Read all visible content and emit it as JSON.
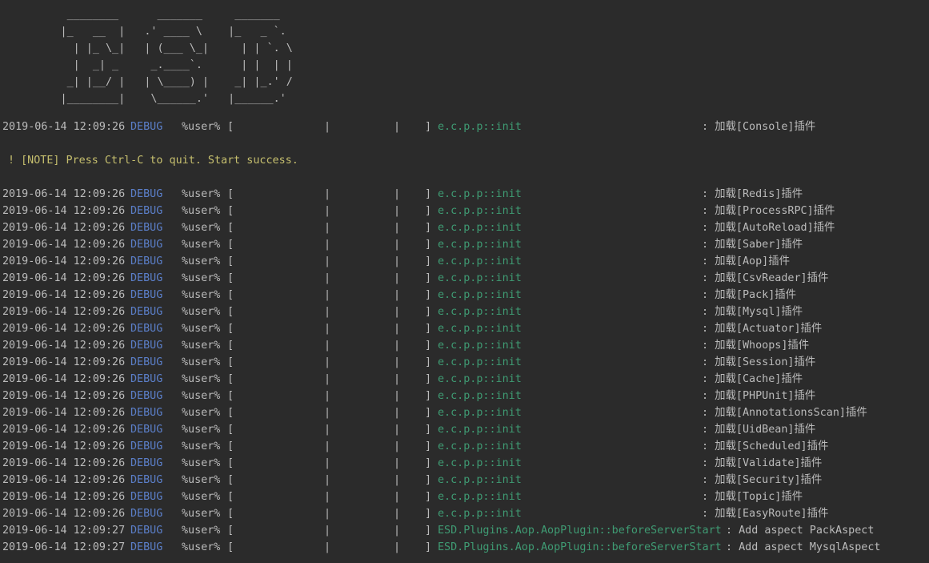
{
  "banner": [
    "          ________      _______     _______",
    "         |_   __  |   .' ____ \\    |_   _ `.",
    "           | |_ \\_|   | (___ \\_|     | | `. \\",
    "           |  _| _     _.____`.      | |  | |",
    "          _| |__/ |   | \\____) |    _| |_.' /",
    "         |________|    \\______.'   |______.'"
  ],
  "first_row": {
    "date": "2019-06-14 12:09:26",
    "level": "DEBUG",
    "user": "%user%",
    "lb": "[",
    "p1": "|",
    "p2": "|",
    "rb": "]",
    "source": "e.c.p.p::init",
    "message": ": 加载[Console]插件"
  },
  "note": "! [NOTE] Press Ctrl-C to quit. Start success.",
  "rows": [
    {
      "date": "2019-06-14 12:09:26",
      "level": "DEBUG",
      "user": "%user%",
      "lb": "[",
      "p1": "|",
      "p2": "|",
      "rb": "]",
      "source": "e.c.p.p::init",
      "message": ": 加载[Redis]插件"
    },
    {
      "date": "2019-06-14 12:09:26",
      "level": "DEBUG",
      "user": "%user%",
      "lb": "[",
      "p1": "|",
      "p2": "|",
      "rb": "]",
      "source": "e.c.p.p::init",
      "message": ": 加载[ProcessRPC]插件"
    },
    {
      "date": "2019-06-14 12:09:26",
      "level": "DEBUG",
      "user": "%user%",
      "lb": "[",
      "p1": "|",
      "p2": "|",
      "rb": "]",
      "source": "e.c.p.p::init",
      "message": ": 加载[AutoReload]插件"
    },
    {
      "date": "2019-06-14 12:09:26",
      "level": "DEBUG",
      "user": "%user%",
      "lb": "[",
      "p1": "|",
      "p2": "|",
      "rb": "]",
      "source": "e.c.p.p::init",
      "message": ": 加载[Saber]插件"
    },
    {
      "date": "2019-06-14 12:09:26",
      "level": "DEBUG",
      "user": "%user%",
      "lb": "[",
      "p1": "|",
      "p2": "|",
      "rb": "]",
      "source": "e.c.p.p::init",
      "message": ": 加载[Aop]插件"
    },
    {
      "date": "2019-06-14 12:09:26",
      "level": "DEBUG",
      "user": "%user%",
      "lb": "[",
      "p1": "|",
      "p2": "|",
      "rb": "]",
      "source": "e.c.p.p::init",
      "message": ": 加载[CsvReader]插件"
    },
    {
      "date": "2019-06-14 12:09:26",
      "level": "DEBUG",
      "user": "%user%",
      "lb": "[",
      "p1": "|",
      "p2": "|",
      "rb": "]",
      "source": "e.c.p.p::init",
      "message": ": 加载[Pack]插件"
    },
    {
      "date": "2019-06-14 12:09:26",
      "level": "DEBUG",
      "user": "%user%",
      "lb": "[",
      "p1": "|",
      "p2": "|",
      "rb": "]",
      "source": "e.c.p.p::init",
      "message": ": 加载[Mysql]插件"
    },
    {
      "date": "2019-06-14 12:09:26",
      "level": "DEBUG",
      "user": "%user%",
      "lb": "[",
      "p1": "|",
      "p2": "|",
      "rb": "]",
      "source": "e.c.p.p::init",
      "message": ": 加载[Actuator]插件"
    },
    {
      "date": "2019-06-14 12:09:26",
      "level": "DEBUG",
      "user": "%user%",
      "lb": "[",
      "p1": "|",
      "p2": "|",
      "rb": "]",
      "source": "e.c.p.p::init",
      "message": ": 加载[Whoops]插件"
    },
    {
      "date": "2019-06-14 12:09:26",
      "level": "DEBUG",
      "user": "%user%",
      "lb": "[",
      "p1": "|",
      "p2": "|",
      "rb": "]",
      "source": "e.c.p.p::init",
      "message": ": 加载[Session]插件"
    },
    {
      "date": "2019-06-14 12:09:26",
      "level": "DEBUG",
      "user": "%user%",
      "lb": "[",
      "p1": "|",
      "p2": "|",
      "rb": "]",
      "source": "e.c.p.p::init",
      "message": ": 加载[Cache]插件"
    },
    {
      "date": "2019-06-14 12:09:26",
      "level": "DEBUG",
      "user": "%user%",
      "lb": "[",
      "p1": "|",
      "p2": "|",
      "rb": "]",
      "source": "e.c.p.p::init",
      "message": ": 加载[PHPUnit]插件"
    },
    {
      "date": "2019-06-14 12:09:26",
      "level": "DEBUG",
      "user": "%user%",
      "lb": "[",
      "p1": "|",
      "p2": "|",
      "rb": "]",
      "source": "e.c.p.p::init",
      "message": ": 加载[AnnotationsScan]插件"
    },
    {
      "date": "2019-06-14 12:09:26",
      "level": "DEBUG",
      "user": "%user%",
      "lb": "[",
      "p1": "|",
      "p2": "|",
      "rb": "]",
      "source": "e.c.p.p::init",
      "message": ": 加载[UidBean]插件"
    },
    {
      "date": "2019-06-14 12:09:26",
      "level": "DEBUG",
      "user": "%user%",
      "lb": "[",
      "p1": "|",
      "p2": "|",
      "rb": "]",
      "source": "e.c.p.p::init",
      "message": ": 加载[Scheduled]插件"
    },
    {
      "date": "2019-06-14 12:09:26",
      "level": "DEBUG",
      "user": "%user%",
      "lb": "[",
      "p1": "|",
      "p2": "|",
      "rb": "]",
      "source": "e.c.p.p::init",
      "message": ": 加载[Validate]插件"
    },
    {
      "date": "2019-06-14 12:09:26",
      "level": "DEBUG",
      "user": "%user%",
      "lb": "[",
      "p1": "|",
      "p2": "|",
      "rb": "]",
      "source": "e.c.p.p::init",
      "message": ": 加载[Security]插件"
    },
    {
      "date": "2019-06-14 12:09:26",
      "level": "DEBUG",
      "user": "%user%",
      "lb": "[",
      "p1": "|",
      "p2": "|",
      "rb": "]",
      "source": "e.c.p.p::init",
      "message": ": 加载[Topic]插件"
    },
    {
      "date": "2019-06-14 12:09:26",
      "level": "DEBUG",
      "user": "%user%",
      "lb": "[",
      "p1": "|",
      "p2": "|",
      "rb": "]",
      "source": "e.c.p.p::init",
      "message": ": 加载[EasyRoute]插件"
    },
    {
      "date": "2019-06-14 12:09:27",
      "level": "DEBUG",
      "user": "%user%",
      "lb": "[",
      "p1": "|",
      "p2": "|",
      "rb": "]",
      "source": "ESD.Plugins.Aop.AopPlugin::beforeServerStart",
      "message": ": Add aspect PackAspect",
      "long": true
    },
    {
      "date": "2019-06-14 12:09:27",
      "level": "DEBUG",
      "user": "%user%",
      "lb": "[",
      "p1": "|",
      "p2": "|",
      "rb": "]",
      "source": "ESD.Plugins.Aop.AopPlugin::beforeServerStart",
      "message": ": Add aspect MysqlAspect",
      "long": true
    }
  ]
}
